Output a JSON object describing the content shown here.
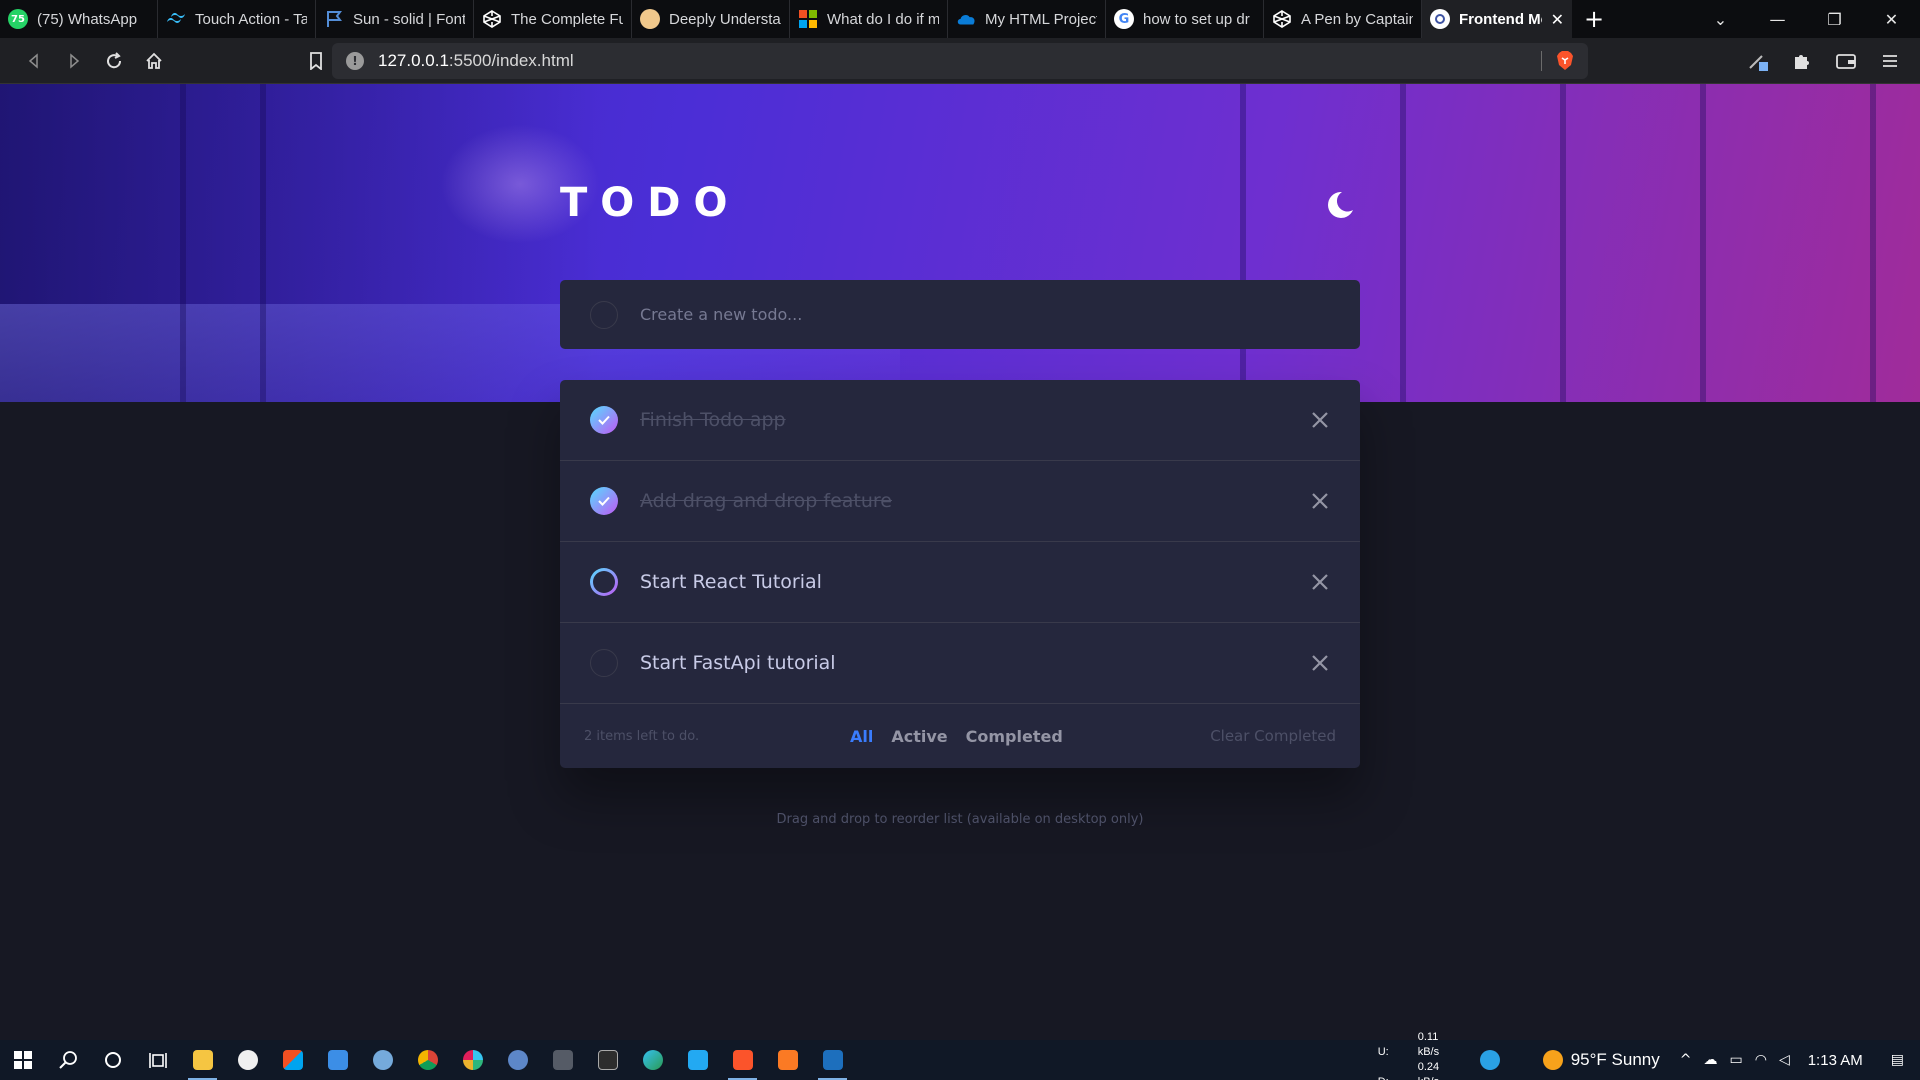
{
  "browser": {
    "tabs": [
      {
        "title": "(75) WhatsApp",
        "badge": "75",
        "color": "#25d366",
        "icon": "whatsapp-icon"
      },
      {
        "title": "Touch Action - Ta",
        "color": "#38bdf8",
        "icon": "tailwind-icon"
      },
      {
        "title": "Sun - solid | Font",
        "color": "#538dd7",
        "icon": "flag-icon"
      },
      {
        "title": "The Complete Fu",
        "color": "#ffffff",
        "icon": "codepen-icon"
      },
      {
        "title": "Deeply Understa",
        "color": "#f0c88c",
        "icon": "monkey-icon"
      },
      {
        "title": "What do I do if m",
        "color": "#f25022",
        "icon": "microsoft-icon"
      },
      {
        "title": "My HTML Project",
        "color": "#0a7cd7",
        "icon": "onedrive-icon"
      },
      {
        "title": "how to set up dr",
        "color": "#4285f4",
        "icon": "google-icon"
      },
      {
        "title": "A Pen by Captain",
        "color": "#ffffff",
        "icon": "codepen-icon"
      }
    ],
    "active_tab": {
      "title": "Frontend Me",
      "icon": "frontendmentor-icon"
    },
    "url": {
      "host": "127.0.0.1",
      "path": ":5500/index.html"
    }
  },
  "app": {
    "title": "TODO",
    "new_todo_placeholder": "Create a new todo...",
    "theme_toggle_icon": "moon-icon",
    "todos": [
      {
        "text": "Finish Todo app",
        "completed": true
      },
      {
        "text": "Add drag and drop feature",
        "completed": true
      },
      {
        "text": "Start React Tutorial",
        "completed": false,
        "hover": true
      },
      {
        "text": "Start FastApi tutorial",
        "completed": false
      }
    ],
    "footer": {
      "items_left": "2 items left to do.",
      "filters": [
        "All",
        "Active",
        "Completed"
      ],
      "active_filter": "All",
      "clear_label": "Clear Completed"
    },
    "hint": "Drag and drop to reorder list (available on desktop only)",
    "colors": {
      "accent": "#3a7cfd",
      "check_from": "#55ddff",
      "check_to": "#c058f3",
      "card": "#25273d",
      "bg": "#171823"
    }
  },
  "taskbar": {
    "net_up": "0.11 kB/s",
    "net_down": "0.24 kB/s",
    "net_up_label": "U:",
    "net_down_label": "D:",
    "weather": "95°F  Sunny",
    "time": "1:13 AM"
  }
}
